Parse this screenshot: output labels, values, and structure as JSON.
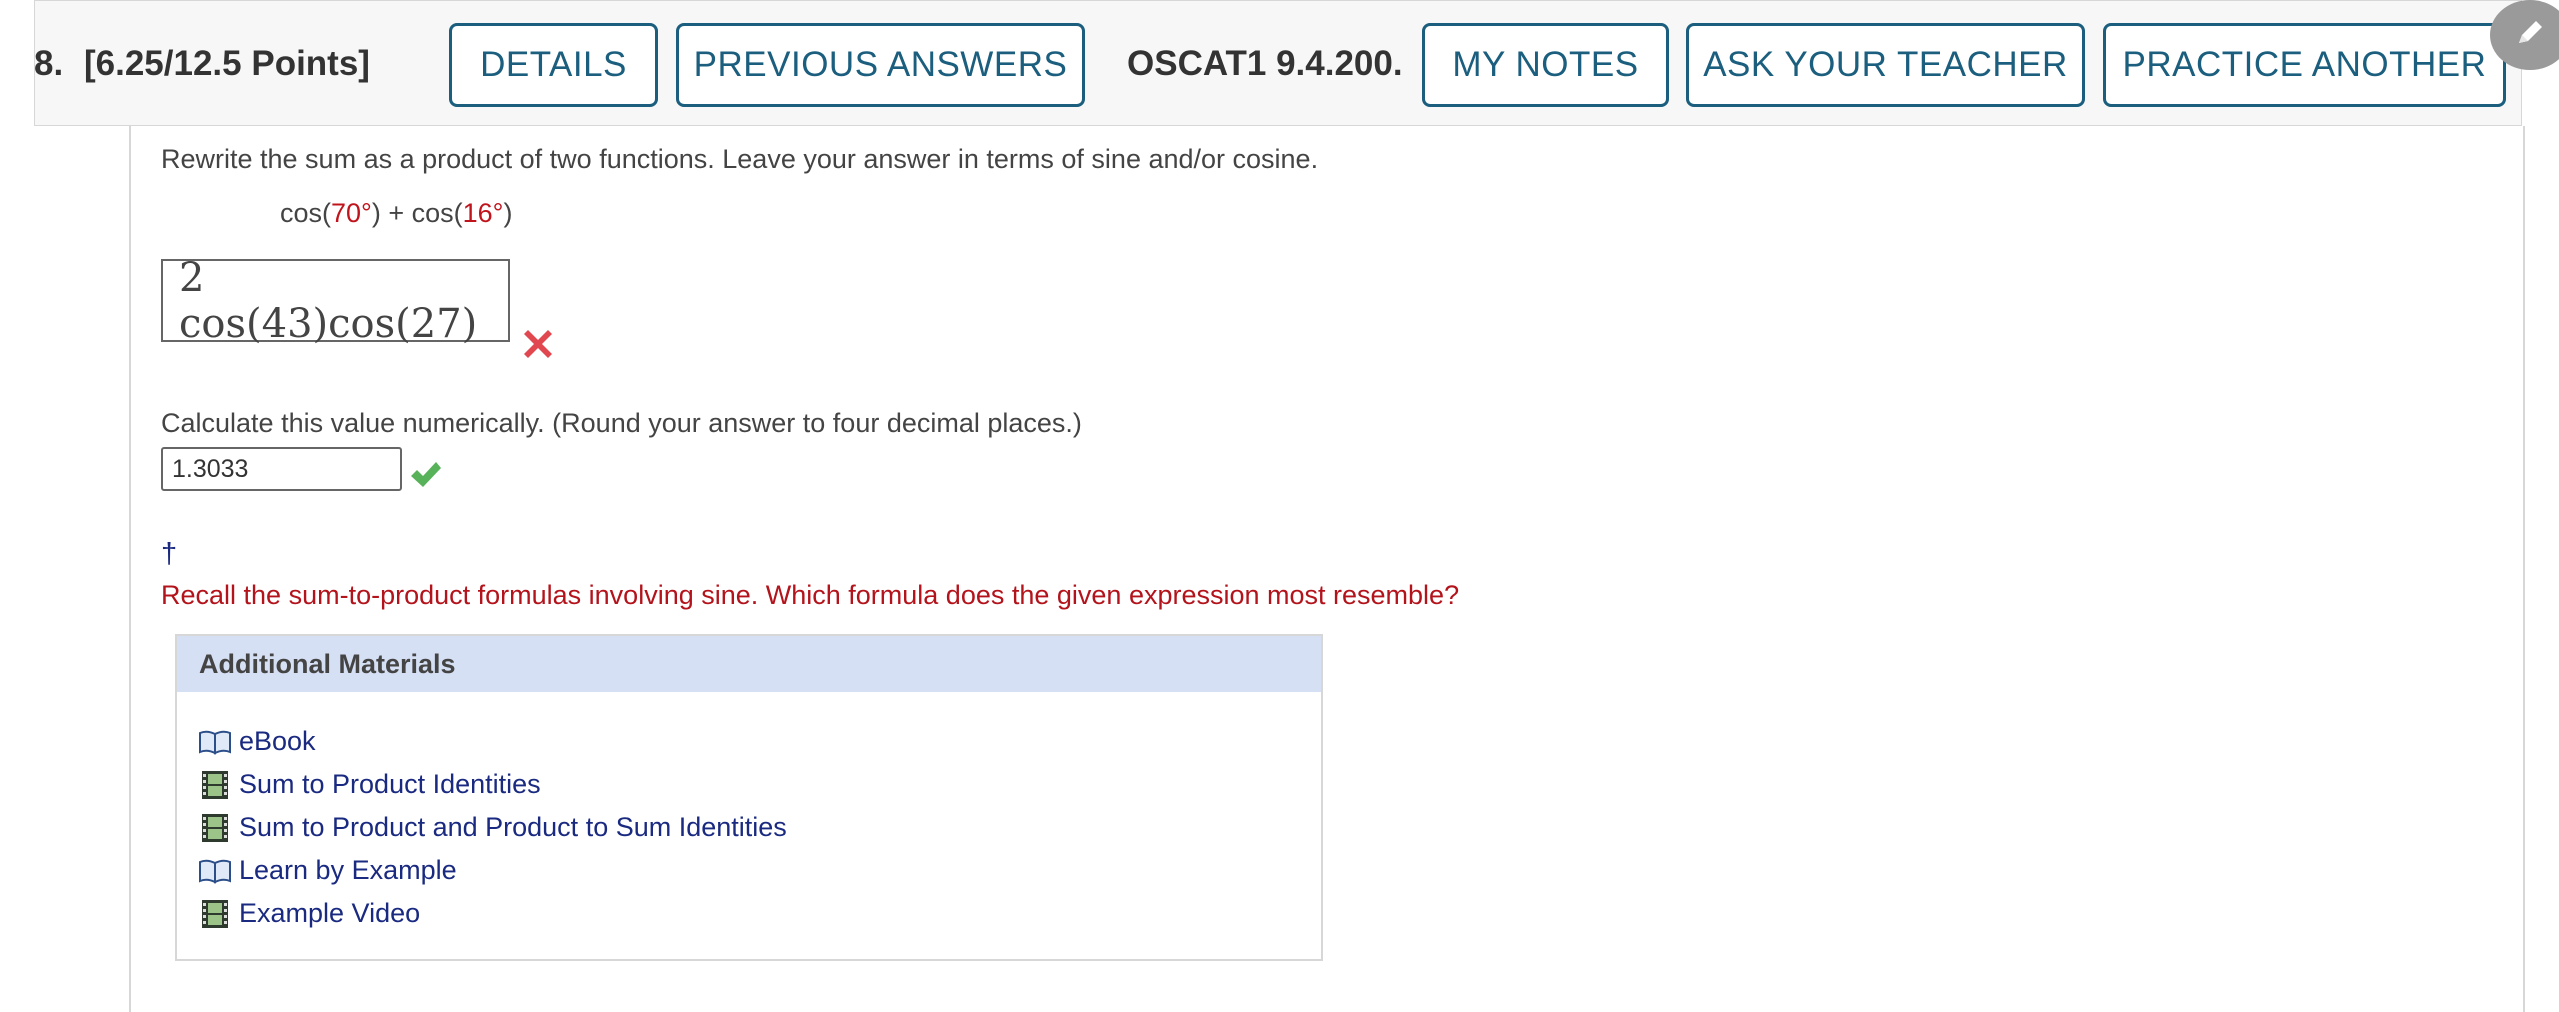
{
  "header": {
    "number": "8.",
    "points": "[6.25/12.5 Points]",
    "details_label": "DETAILS",
    "previous_answers_label": "PREVIOUS ANSWERS",
    "question_id": "OSCAT1 9.4.200.",
    "my_notes_label": "MY NOTES",
    "ask_teacher_label": "ASK YOUR TEACHER",
    "practice_another_label": "PRACTICE ANOTHER"
  },
  "question": {
    "prompt": "Rewrite the sum as a product of two functions. Leave your answer in terms of sine and/or cosine.",
    "expr_part1": "cos(",
    "expr_val1": "70°",
    "expr_part2": ") + cos(",
    "expr_val2": "16°",
    "expr_part3": ")",
    "answer1": "2 cos(43)cos(27)",
    "answer1_status": "incorrect",
    "calc_prompt": "Calculate this value numerically. (Round your answer to four decimal places.)",
    "answer2": "1.3033",
    "answer2_status": "correct",
    "dagger": "†",
    "hint": "Recall the sum-to-product formulas involving sine. Which formula does the given expression most resemble?"
  },
  "additional_materials": {
    "title": "Additional Materials",
    "items": [
      {
        "label": "eBook",
        "icon": "book-icon"
      },
      {
        "label": "Sum to Product Identities",
        "icon": "film-icon"
      },
      {
        "label": "Sum to Product and Product to Sum Identities",
        "icon": "film-icon"
      },
      {
        "label": "Learn by Example",
        "icon": "book-icon"
      },
      {
        "label": "Example Video",
        "icon": "film-icon"
      }
    ]
  },
  "colors": {
    "accent": "#1b5e7e",
    "error": "#c0141c",
    "success": "#4aa84a",
    "materials_header": "#d6e0f5",
    "link": "#1a2a80"
  }
}
